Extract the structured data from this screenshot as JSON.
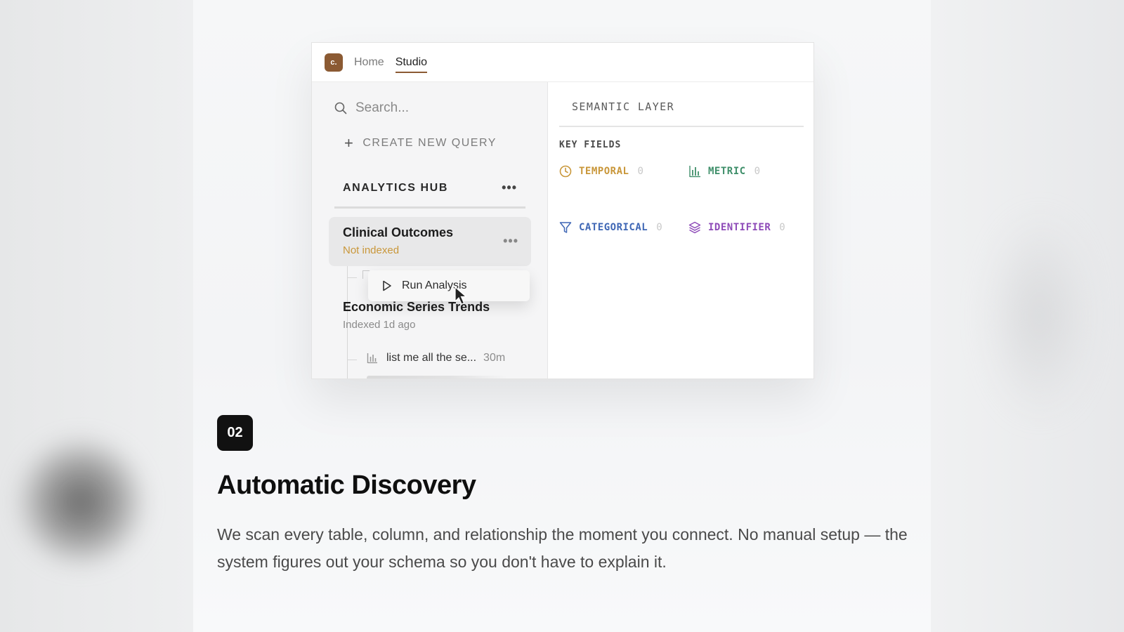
{
  "app": {
    "logo_text": "c.",
    "nav": [
      {
        "label": "Home",
        "active": false
      },
      {
        "label": "Studio",
        "active": true
      }
    ],
    "brand_color": "#8b5a33"
  },
  "sidebar": {
    "search_placeholder": "Search...",
    "create_label": "CREATE NEW QUERY",
    "hub_title": "ANALYTICS HUB",
    "items": [
      {
        "title": "Clinical Outcomes",
        "status": "Not indexed",
        "status_color": "#c9973a"
      },
      {
        "title": "Economic Series Trends",
        "status": "Indexed 1d ago",
        "status_color": "#8a8a8a"
      }
    ],
    "context_menu_label": "Run Analysis",
    "sub_queries": [
      {
        "label": "list me all the se...",
        "time": "30m"
      }
    ]
  },
  "semantic": {
    "title": "SEMANTIC LAYER",
    "key_fields_label": "KEY FIELDS",
    "fields": [
      {
        "label": "TEMPORAL",
        "count": "0",
        "color": "#c9973a",
        "icon": "clock-icon"
      },
      {
        "label": "METRIC",
        "count": "0",
        "color": "#3f8f6a",
        "icon": "bar-chart-icon"
      },
      {
        "label": "CATEGORICAL",
        "count": "0",
        "color": "#3f67b5",
        "icon": "filter-icon"
      },
      {
        "label": "IDENTIFIER",
        "count": "0",
        "color": "#8e4bb8",
        "icon": "layers-icon"
      }
    ]
  },
  "feature": {
    "step": "02",
    "headline": "Automatic Discovery",
    "body": "We scan every table, column, and relationship the moment you connect. No manual setup — the system figures out your schema so you don't have to explain it."
  }
}
